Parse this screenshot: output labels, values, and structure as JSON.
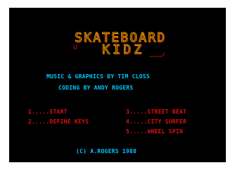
{
  "title": {
    "line1": "SKATEBOARD",
    "line2": "KIDZ"
  },
  "credits": {
    "music_graphics": "MUSIC & GRAPHICS BY TIM CLOSS",
    "coding": "CODING BY ANDY ROGERS"
  },
  "menu": {
    "left": [
      "1.....START",
      "2.....DEFINE KEYS"
    ],
    "right": [
      "3.....STREET BEAT",
      "4.....CITY SURFER",
      "5.....WHEEL SPIN"
    ]
  },
  "copyright": "(C) A.ROGERS 1988",
  "colors": {
    "background": "#000000",
    "border": "#ffffff",
    "credits_text": "#00c8ff",
    "menu_text": "#e01010",
    "logo_yellow": "#ffd400",
    "logo_red": "#e01010"
  }
}
